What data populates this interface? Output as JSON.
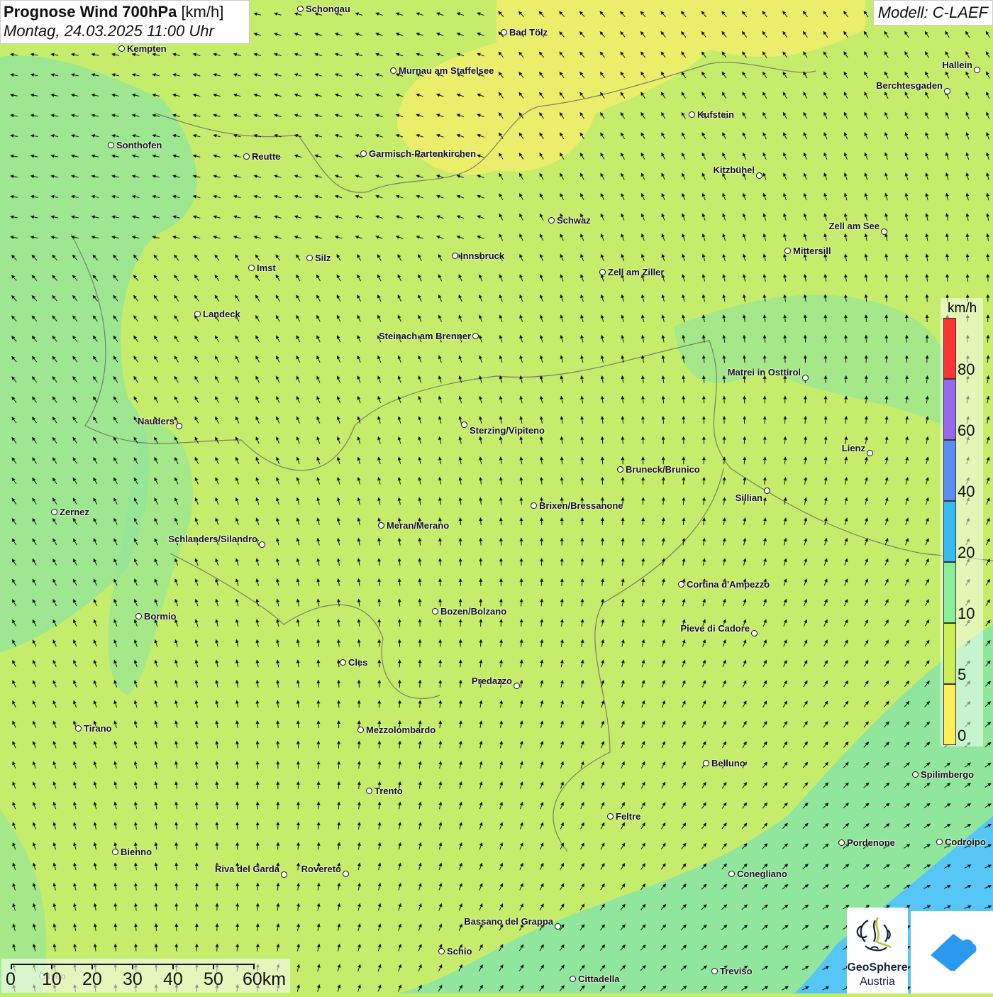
{
  "header": {
    "title_bold": "Prognose Wind 700hPa",
    "title_unit": "[km/h]",
    "datetime": "Montag, 24.03.2025 11:00 Uhr",
    "model": "Modell: C-LAEF"
  },
  "legend": {
    "unit": "km/h",
    "labels": [
      "80",
      "60",
      "40",
      "20",
      "10",
      "5",
      "0"
    ],
    "colors": [
      "#ff3333",
      "#9966ee",
      "#5a8cf5",
      "#33bbf5",
      "#88ee99",
      "#ccee55",
      "#ffee55"
    ]
  },
  "scale_bar": {
    "labels": [
      "0",
      "10",
      "20",
      "30",
      "40",
      "50",
      "60km"
    ]
  },
  "logos": {
    "geosphere_line1": "GeoSphere",
    "geosphere_line2": "Austria"
  },
  "colors": {
    "base": "#c6ec6c",
    "calm_yellow": "#f6ef6a",
    "light_green": "#8fe69c",
    "blue": "#55c6f5"
  },
  "cities": [
    "Schongau",
    "Kempten",
    "Bad Tölz",
    "Murnau am Staffelsee",
    "Hallein",
    "Berchtesgaden",
    "Kufstein",
    "Sonthofen",
    "Reutte",
    "Garmisch-Partenkirchen",
    "Kitzbühel",
    "Schwaz",
    "Zell am See",
    "Mittersill",
    "Innsbruck",
    "Silz",
    "Imst",
    "Zell am Ziller",
    "Landeck",
    "Steinach am Brenner",
    "Matrei in Osttirol",
    "Nauders",
    "Sterzing/Vipiteno",
    "Lienz",
    "Bruneck/Brunico",
    "Sillian",
    "Brixen/Bressanone",
    "Zernez",
    "Meran/Merano",
    "Schlanders/Silandro",
    "Cortina d'Ampezzo",
    "Bozen/Bolzano",
    "Bormio",
    "Pieve di Cadore",
    "Cles",
    "Predazzo",
    "Tirano",
    "Mezzolombardo",
    "Belluno",
    "Spilimbergo",
    "Trento",
    "Feltre",
    "Pordenone",
    "Codroipo",
    "Bienno",
    "Riva del Garda",
    "Rovereto",
    "Conegliano",
    "Bassano del Grappa",
    "Schio",
    "Treviso",
    "Cittadella",
    "Iseo"
  ]
}
